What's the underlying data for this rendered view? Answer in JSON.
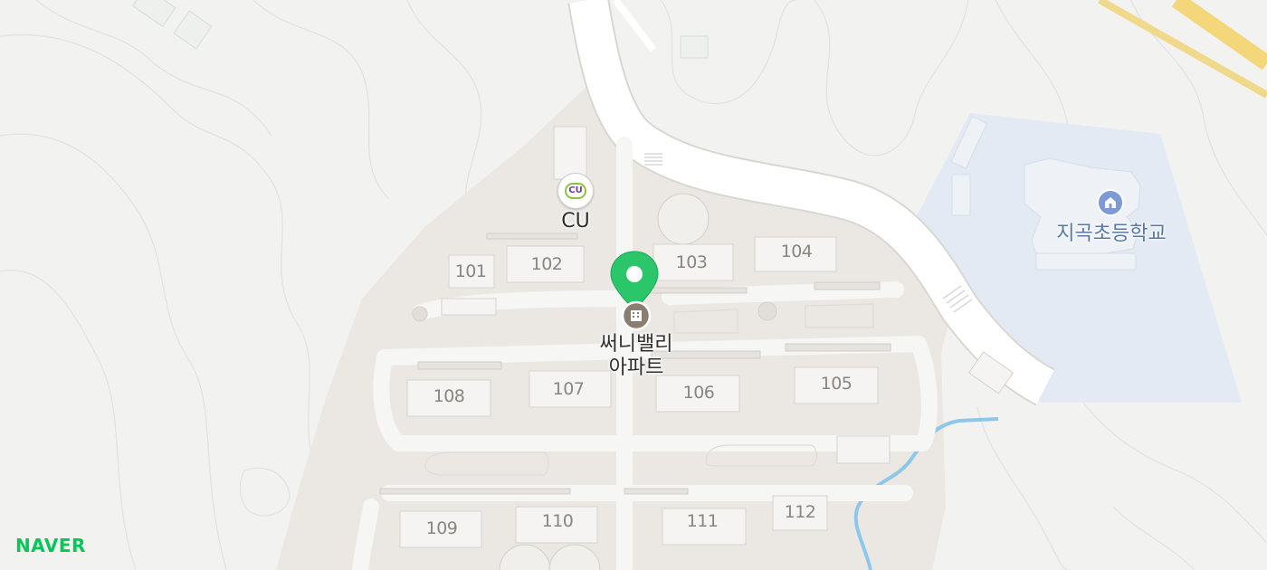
{
  "map": {
    "provider_logo": "NAVER",
    "colors": {
      "background": "#f2f3f1",
      "complex_area": "#ebe8e4",
      "road": "#ffffff",
      "school_area": "#e3eaf3",
      "stream": "#8ec7ea",
      "highway": "#f3d77a",
      "marker": "#2bc56a"
    },
    "buildings": [
      "101",
      "102",
      "103",
      "104",
      "105",
      "106",
      "107",
      "108",
      "109",
      "110",
      "111",
      "112"
    ],
    "pois": {
      "store": {
        "label": "CU",
        "icon": "cu-store-icon"
      },
      "apartment": {
        "line1": "써니밸리",
        "line2": "아파트",
        "icon": "apartment-building-icon"
      },
      "school": {
        "label": "지곡초등학교",
        "icon": "school-icon"
      }
    }
  }
}
